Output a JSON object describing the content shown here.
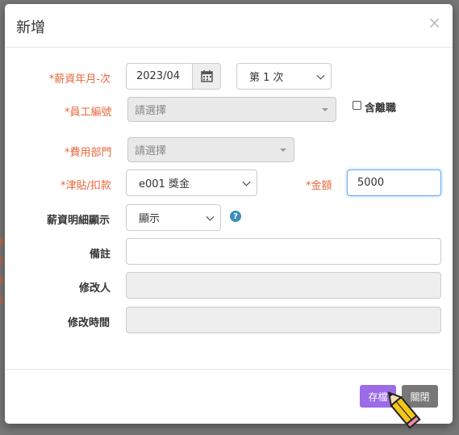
{
  "dialog": {
    "title": "新增",
    "close_glyph": "×"
  },
  "form": {
    "salary_month_label": "*薪資年月-次",
    "salary_month_value": "2023/04",
    "salary_seq_value": "第 1 次",
    "employee_label": "*員工編號",
    "employee_placeholder": "請選擇",
    "include_resigned_label": "含離職",
    "department_label": "*費用部門",
    "department_placeholder": "請選擇",
    "allowance_label": "*津貼/扣款",
    "allowance_value": "e001 獎金",
    "amount_label": "*金額",
    "amount_value": "5000",
    "detail_display_label": "薪資明細顯示",
    "detail_display_value": "顯示",
    "help_glyph": "?",
    "note_label": "備註",
    "note_value": "",
    "modified_by_label": "修改人",
    "modified_time_label": "修改時間"
  },
  "footer": {
    "save_label": "存檔",
    "close_label": "關閉"
  },
  "colors": {
    "save_button": "#9b6be8",
    "close_button": "#777777",
    "required_label": "#e8673c",
    "help_icon": "#3c8dbc"
  }
}
